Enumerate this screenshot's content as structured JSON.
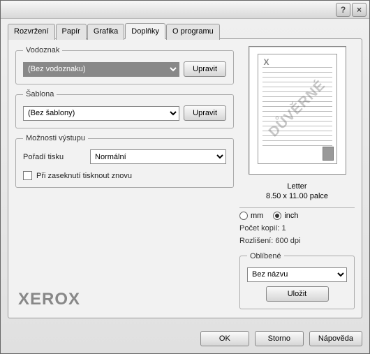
{
  "titlebar": {
    "help": "?",
    "close": "×"
  },
  "tabs": {
    "layout": "Rozvržení",
    "paper": "Papír",
    "graphics": "Grafika",
    "extras": "Doplňky",
    "about": "O programu"
  },
  "watermark": {
    "legend": "Vodoznak",
    "value": "(Bez vodoznaku)",
    "edit": "Upravit"
  },
  "overlay": {
    "legend": "Šablona",
    "value": "(Bez šablony)",
    "edit": "Upravit"
  },
  "output": {
    "legend": "Možnosti výstupu",
    "order_label": "Pořadí tisku",
    "order_value": "Normální",
    "reprint_label": "Při zaseknutí tisknout znovu"
  },
  "preview": {
    "corner_mark": "X",
    "watermark_text": "DŮVĚRNÉ",
    "paper_name": "Letter",
    "paper_size": "8.50 x 11.00 palce"
  },
  "units": {
    "mm": "mm",
    "inch": "inch"
  },
  "info": {
    "copies": "Počet kopií: 1",
    "resolution": "Rozlišení: 600 dpi"
  },
  "favorites": {
    "legend": "Oblíbené",
    "value": "Bez názvu",
    "save": "Uložit"
  },
  "logo": "XEROX",
  "footer": {
    "ok": "OK",
    "cancel": "Storno",
    "help": "Nápověda"
  }
}
